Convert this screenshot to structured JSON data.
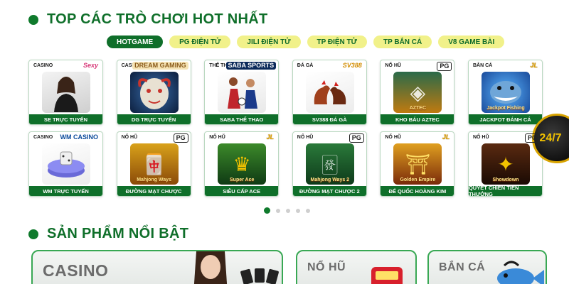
{
  "sections": {
    "top_games_title": "TOP CÁC TRÒ CHƠI HOT NHẤT",
    "featured_title": "SẢN PHẨM NỔI BẬT"
  },
  "tabs": [
    {
      "label": "HOTGAME",
      "active": true
    },
    {
      "label": "PG ĐIỆN TỬ",
      "active": false
    },
    {
      "label": "JILI ĐIỆN TỬ",
      "active": false
    },
    {
      "label": "TP ĐIỆN TỬ",
      "active": false
    },
    {
      "label": "TP BẮN CÁ",
      "active": false
    },
    {
      "label": "V8 GAME BÀI",
      "active": false
    }
  ],
  "games": [
    {
      "category": "CASINO",
      "provider": "Sexy",
      "art_text": "",
      "name": "SE TRỰC TUYẾN"
    },
    {
      "category": "CASINO",
      "provider": "DREAM GAMING",
      "art_text": "",
      "name": "DG TRỰC TUYẾN"
    },
    {
      "category": "THỂ THAO",
      "provider": "SABA SPORTS",
      "art_text": "",
      "name": "SABA THỂ THAO"
    },
    {
      "category": "ĐÁ GÀ",
      "provider": "SV388",
      "art_text": "",
      "name": "SV388 ĐÁ GÀ"
    },
    {
      "category": "NỔ HŨ",
      "provider": "PG",
      "art_text": "AZTEC",
      "name": "KHO BÁU AZTEC"
    },
    {
      "category": "BẮN CÁ",
      "provider": "JL",
      "art_text": "Jackpot Fishing",
      "name": "JACKPOT ĐÁNH CÁ"
    },
    {
      "category": "CASINO",
      "provider": "WM CASINO",
      "art_text": "",
      "name": "WM TRỰC TUYẾN"
    },
    {
      "category": "NỔ HŨ",
      "provider": "PG",
      "art_text": "Mahjong Ways",
      "name": "ĐƯỜNG MẠT CHƯỢC"
    },
    {
      "category": "NỔ HŨ",
      "provider": "JL",
      "art_text": "Super Ace",
      "name": "SIÊU CẤP ACE"
    },
    {
      "category": "NỔ HŨ",
      "provider": "PG",
      "art_text": "Mahjong Ways 2",
      "name": "ĐƯỜNG MẠT CHƯỢC 2"
    },
    {
      "category": "NỔ HŨ",
      "provider": "JL",
      "art_text": "Golden Empire",
      "name": "ĐẾ QUỐC HOÀNG KIM"
    },
    {
      "category": "NỔ HŨ",
      "provider": "PG",
      "art_text": "Showdown",
      "name": "QUYẾT CHIẾN TIỀN THƯỞNG"
    }
  ],
  "support_badge": "24/7",
  "pagination": {
    "count": 5,
    "active": 0
  },
  "featured": [
    {
      "label": "CASINO"
    },
    {
      "label": "NỔ HŨ"
    },
    {
      "label": "BẮN CÁ"
    }
  ],
  "colors": {
    "brand_green": "#0f6f2a",
    "tab_yellow": "#f1f18a",
    "badge_gold": "#d9a400"
  }
}
